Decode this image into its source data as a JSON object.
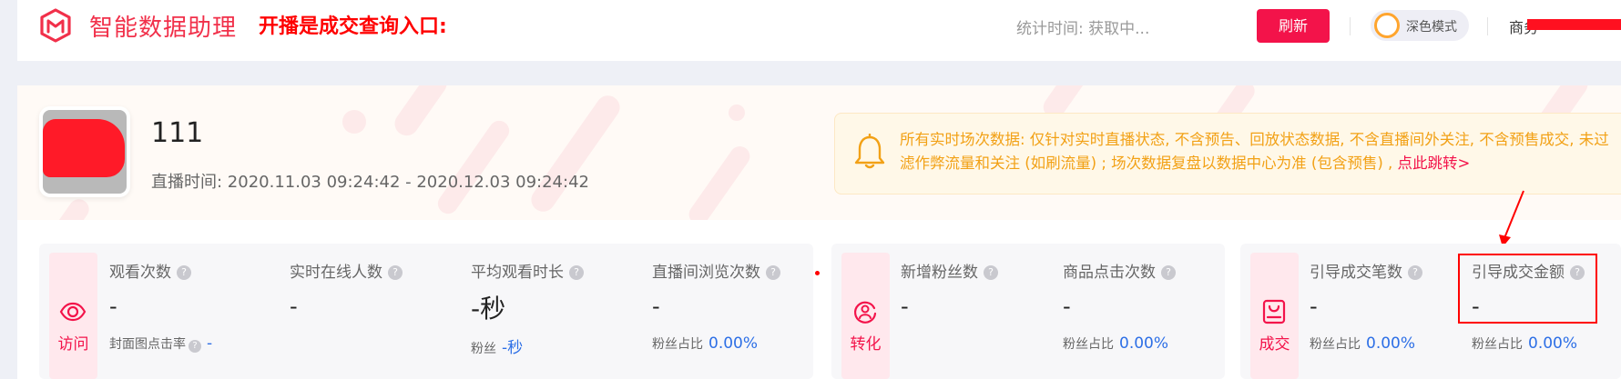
{
  "header": {
    "app_title": "智能数据助理",
    "entry_text": "开播是成交查询入口:",
    "stat_time": "统计时间: 获取中...",
    "refresh_label": "刷新",
    "dark_mode_label": "深色模式",
    "account_text": "商务"
  },
  "room": {
    "name": "111",
    "live_time": "直播时间: 2020.11.03 09:24:42 - 2020.12.03 09:24:42"
  },
  "notice": {
    "text": "所有实时场次数据: 仅针对实时直播状态, 不含预告、回放状态数据, 不含直播间外关注, 不含预售成交, 未过滤作弊流量和关注 (如刷流量) ; 场次数据复盘以数据中心为准 (包含预售) , ",
    "link": "点此跳转>"
  },
  "groups": {
    "visit": {
      "category": "访问",
      "metrics": [
        {
          "label": "观看次数",
          "value": "-",
          "sub_label": "封面图点击率",
          "sub_value": "-"
        },
        {
          "label": "实时在线人数",
          "value": "-"
        },
        {
          "label": "平均观看时长",
          "value": "-秒",
          "sub_label": "粉丝",
          "sub_value": "-秒"
        },
        {
          "label": "直播间浏览次数",
          "value": "-",
          "sub_label": "粉丝占比",
          "sub_value": "0.00%"
        }
      ]
    },
    "convert": {
      "category": "转化",
      "metrics": [
        {
          "label": "新增粉丝数",
          "value": "-"
        },
        {
          "label": "商品点击次数",
          "value": "-",
          "sub_label": "粉丝占比",
          "sub_value": "0.00%"
        }
      ]
    },
    "deal": {
      "category": "成交",
      "metrics": [
        {
          "label": "引导成交笔数",
          "value": "-",
          "sub_label": "粉丝占比",
          "sub_value": "0.00%"
        },
        {
          "label": "引导成交金额",
          "value": "-",
          "sub_label": "粉丝占比",
          "sub_value": "0.00%"
        }
      ]
    }
  },
  "help_glyph": "?",
  "colors": {
    "brand": "#f3134a",
    "notice_text": "#f2a116",
    "value_blue": "#2d6fe6",
    "annotation_red": "#ff0000"
  }
}
